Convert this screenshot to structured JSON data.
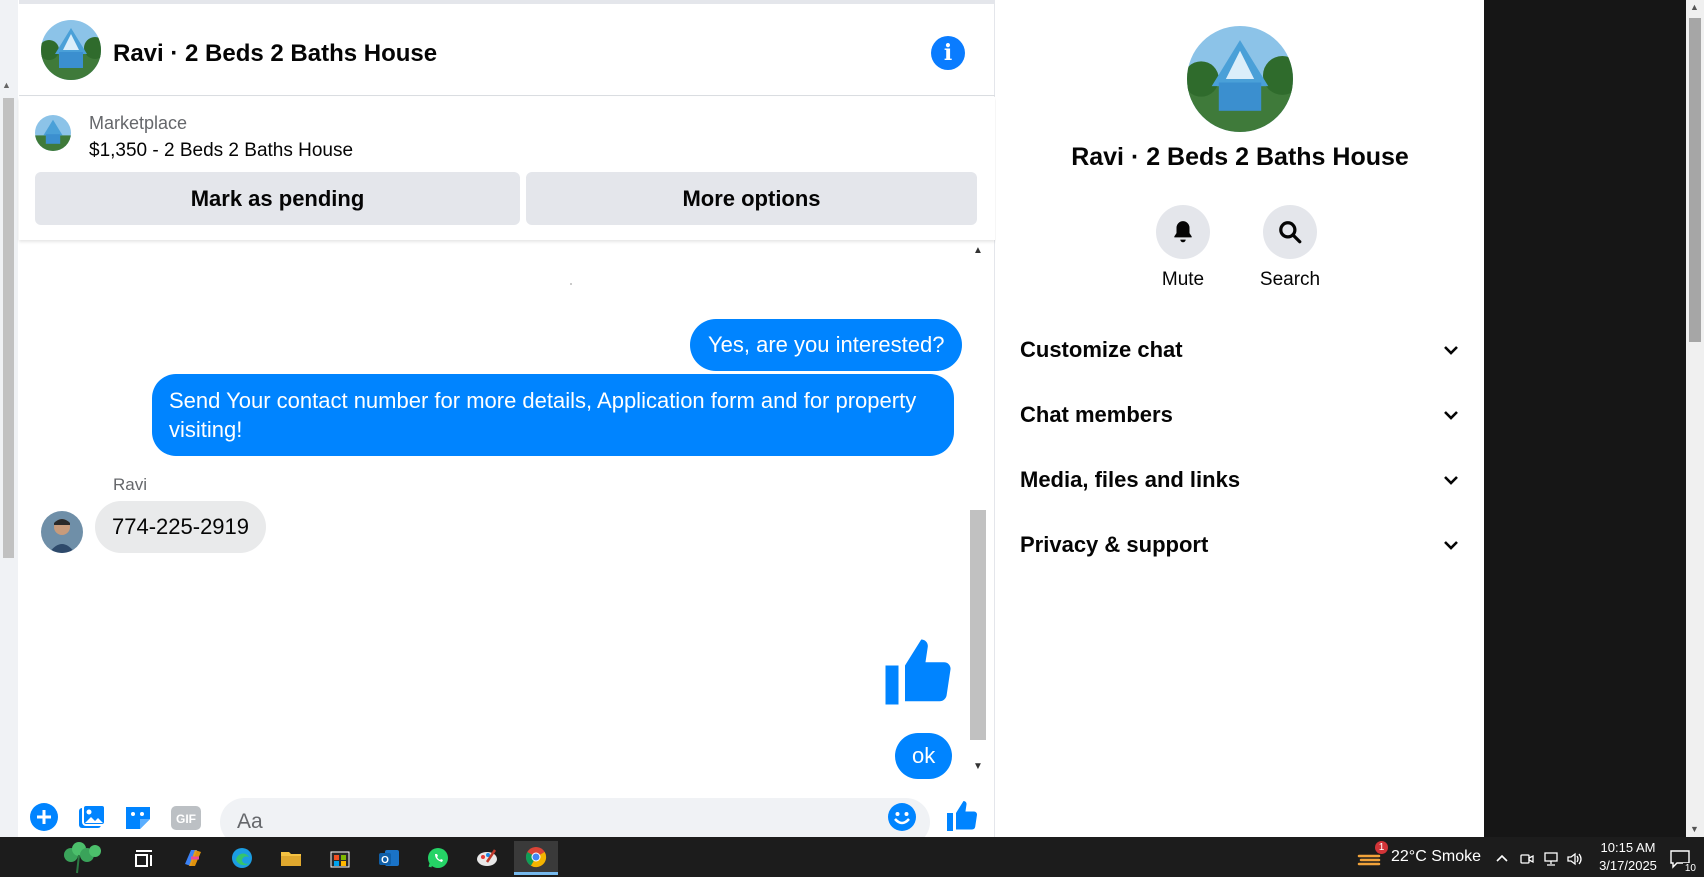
{
  "chat": {
    "title": "Ravi · 2 Beds 2 Baths House",
    "info_icon": "info-icon",
    "marketplace": {
      "label": "Marketplace",
      "listing": "$1,350 - 2 Beds 2 Baths House",
      "mark_pending_label": "Mark as pending",
      "more_options_label": "More options"
    },
    "messages": [
      {
        "direction": "outgoing",
        "text": "Yes, are you interested?"
      },
      {
        "direction": "outgoing",
        "text": "Send Your contact number for more details, Application form and for property visiting!"
      },
      {
        "direction": "incoming",
        "sender": "Ravi",
        "text": "774-225-2919"
      },
      {
        "direction": "outgoing",
        "type": "like-sticker",
        "icon": "thumbs-up-icon"
      },
      {
        "direction": "outgoing",
        "text": "ok"
      }
    ],
    "composer": {
      "placeholder": "Aa",
      "gif_label": "GIF"
    }
  },
  "details": {
    "title": "Ravi · 2 Beds 2 Baths House",
    "actions": [
      {
        "label": "Mute",
        "icon": "bell-icon"
      },
      {
        "label": "Search",
        "icon": "search-icon"
      }
    ],
    "sections": [
      {
        "label": "Customize chat"
      },
      {
        "label": "Chat members"
      },
      {
        "label": "Media, files and links"
      },
      {
        "label": "Privacy & support"
      }
    ]
  },
  "taskbar": {
    "weather_badge": "1",
    "weather": "22°C  Smoke",
    "time": "10:15 AM",
    "date": "3/17/2025",
    "notification_count": "10"
  },
  "colors": {
    "messenger_blue": "#0084ff",
    "info_blue": "#0a7cff",
    "incoming_bubble": "#e9eaeb",
    "button_gray": "#e4e6eb"
  }
}
